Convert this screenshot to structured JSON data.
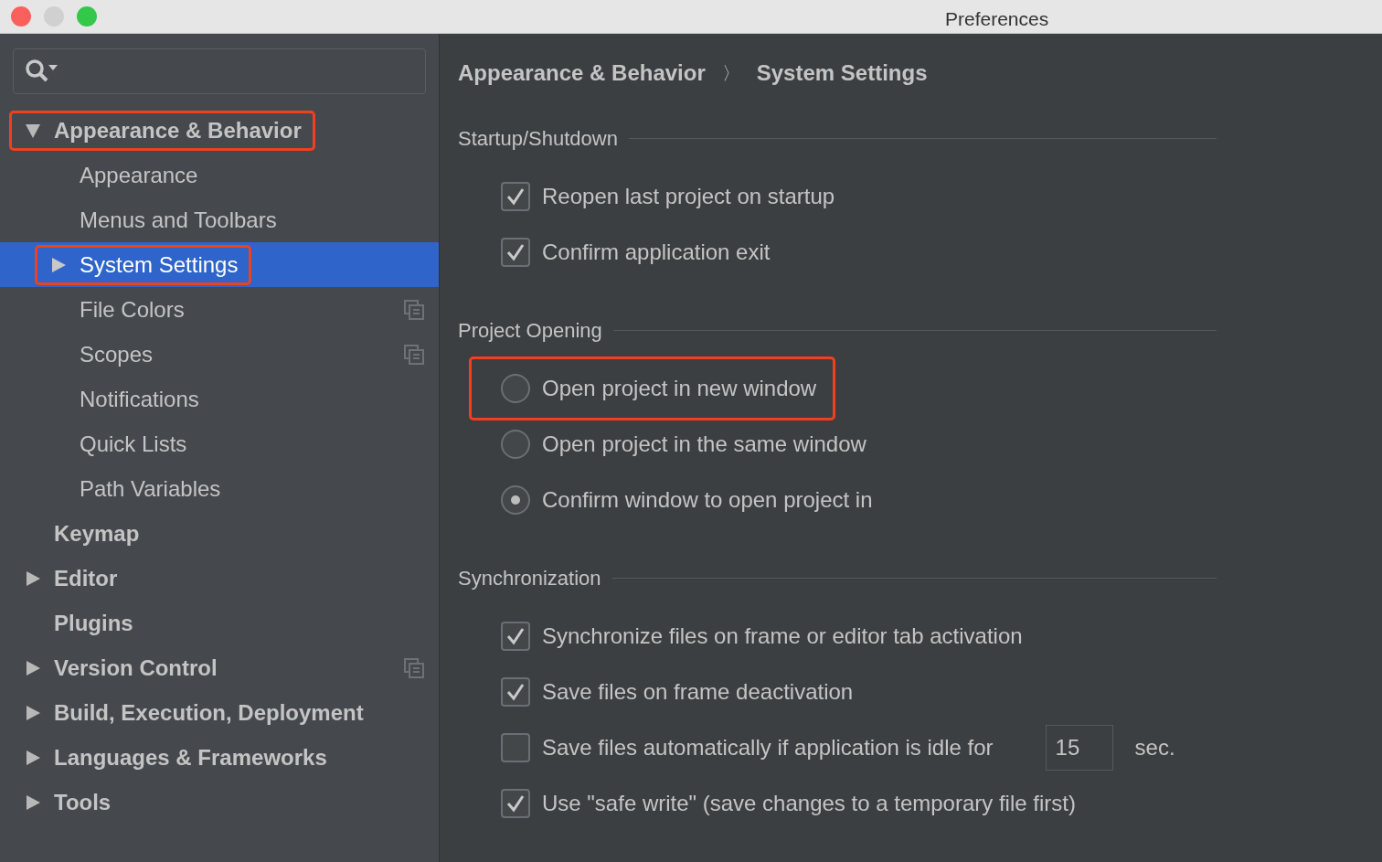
{
  "window": {
    "title": "Preferences"
  },
  "tree": [
    {
      "label": "Appearance & Behavior",
      "bold": true,
      "expanded": true,
      "highlighted": true,
      "selected": false,
      "children": [
        {
          "label": "Appearance",
          "selected": false
        },
        {
          "label": "Menus and Toolbars",
          "selected": false
        },
        {
          "label": "System Settings",
          "expanded": false,
          "highlighted": true,
          "selected": true
        },
        {
          "label": "File Colors",
          "project_scope": true,
          "selected": false
        },
        {
          "label": "Scopes",
          "project_scope": true,
          "selected": false
        },
        {
          "label": "Notifications",
          "selected": false
        },
        {
          "label": "Quick Lists",
          "selected": false
        },
        {
          "label": "Path Variables",
          "selected": false
        }
      ]
    },
    {
      "label": "Keymap",
      "bold": true,
      "selected": false
    },
    {
      "label": "Editor",
      "bold": true,
      "expanded": false,
      "selected": false
    },
    {
      "label": "Plugins",
      "bold": true,
      "selected": false
    },
    {
      "label": "Version Control",
      "bold": true,
      "expanded": false,
      "project_scope": true,
      "selected": false
    },
    {
      "label": "Build, Execution, Deployment",
      "bold": true,
      "expanded": false,
      "selected": false
    },
    {
      "label": "Languages & Frameworks",
      "bold": true,
      "expanded": false,
      "selected": false
    },
    {
      "label": "Tools",
      "bold": true,
      "expanded": false,
      "selected": false
    }
  ],
  "breadcrumb": [
    "Appearance & Behavior",
    "System Settings"
  ],
  "breadcrumb_separator": "〉",
  "sections": [
    {
      "title": "Startup/Shutdown",
      "options": [
        {
          "kind": "checkbox",
          "label": "Reopen last project on startup",
          "checked": true
        },
        {
          "kind": "checkbox",
          "label": "Confirm application exit",
          "checked": true
        }
      ]
    },
    {
      "title": "Project Opening",
      "options": [
        {
          "kind": "radio",
          "label": "Open project in new window",
          "selected": false,
          "highlighted": true
        },
        {
          "kind": "radio",
          "label": "Open project in the same window",
          "selected": false
        },
        {
          "kind": "radio",
          "label": "Confirm window to open project in",
          "selected": true
        }
      ]
    },
    {
      "title": "Synchronization",
      "options": [
        {
          "kind": "checkbox",
          "label": "Synchronize files on frame or editor tab activation",
          "checked": true
        },
        {
          "kind": "checkbox",
          "label": "Save files on frame deactivation",
          "checked": true
        },
        {
          "kind": "checkbox",
          "label": "Save files automatically if application is idle for",
          "checked": false,
          "value": "15",
          "suffix": "sec."
        },
        {
          "kind": "checkbox",
          "label": "Use \"safe write\" (save changes to a temporary file first)",
          "checked": true
        }
      ]
    }
  ]
}
